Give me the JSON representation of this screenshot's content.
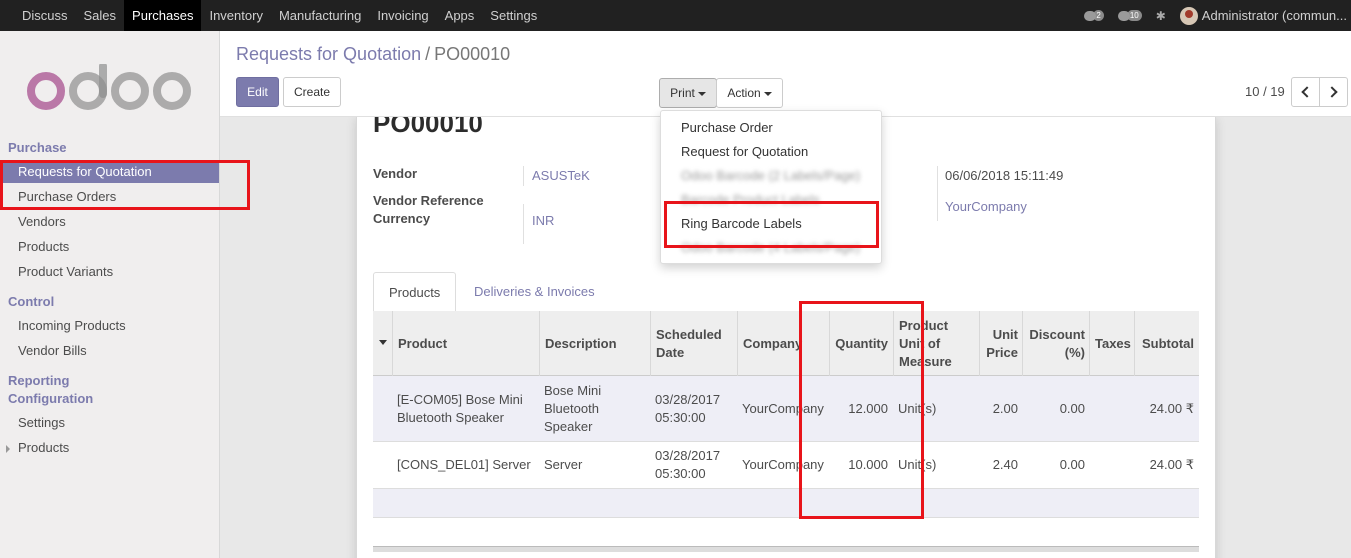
{
  "topbar": {
    "menu": [
      "Discuss",
      "Sales",
      "Purchases",
      "Inventory",
      "Manufacturing",
      "Invoicing",
      "Apps",
      "Settings"
    ],
    "active": "Purchases",
    "messages_count": "2",
    "chat_count": "10",
    "user": "Administrator (commun..."
  },
  "sidebar": {
    "logo": "odoo",
    "sections": {
      "purchase": "Purchase",
      "control": "Control",
      "reporting": "Reporting",
      "configuration": "Configuration"
    },
    "items": {
      "rfq": "Requests for Quotation",
      "po": "Purchase Orders",
      "vendors": "Vendors",
      "products": "Products",
      "variants": "Product Variants",
      "incoming": "Incoming Products",
      "bills": "Vendor Bills",
      "settings": "Settings",
      "products2": "Products"
    }
  },
  "control_panel": {
    "breadcrumb_parent": "Requests for Quotation",
    "breadcrumb_sep": "/",
    "breadcrumb_current": "PO00010",
    "edit": "Edit",
    "create": "Create",
    "print": "Print",
    "action": "Action",
    "pager": "10 / 19"
  },
  "print_menu": {
    "items": [
      "Purchase Order",
      "Request for Quotation",
      "Odoo Barcode (2 Labels/Page)",
      "Barcode Product Labels",
      "Ring Barcode Labels",
      "Odoo Barcode (4 Labels/Page)"
    ]
  },
  "form": {
    "title": "PO00010",
    "vendor_label": "Vendor",
    "vendor_value": "ASUSTeK",
    "vendor_ref_label": "Vendor Reference",
    "currency_label": "Currency",
    "currency_value": "INR",
    "order_date": "06/06/2018 15:11:49",
    "company_value": "YourCompany",
    "tabs": [
      "Products",
      "Deliveries & Invoices"
    ]
  },
  "table": {
    "headers": [
      "Product",
      "Description",
      "Scheduled Date",
      "Company",
      "Quantity",
      "Product Unit of Measure",
      "Unit Price",
      "Discount (%)",
      "Taxes",
      "Subtotal"
    ],
    "rows": [
      {
        "product": "[E-COM05] Bose Mini Bluetooth Speaker",
        "description": "Bose Mini Bluetooth Speaker",
        "date": "03/28/2017 05:30:00",
        "company": "YourCompany",
        "quantity": "12.000",
        "uom": "Unit(s)",
        "price": "2.00",
        "discount": "0.00",
        "taxes": "",
        "subtotal": "24.00 ₹"
      },
      {
        "product": "[CONS_DEL01] Server",
        "description": "Server",
        "date": "03/28/2017 05:30:00",
        "company": "YourCompany",
        "quantity": "10.000",
        "uom": "Unit(s)",
        "price": "2.40",
        "discount": "0.00",
        "taxes": "",
        "subtotal": "24.00 ₹"
      }
    ]
  },
  "colors": {
    "brand": "#7c7bad",
    "topbar": "#212121",
    "highlight": "#e8141a"
  }
}
